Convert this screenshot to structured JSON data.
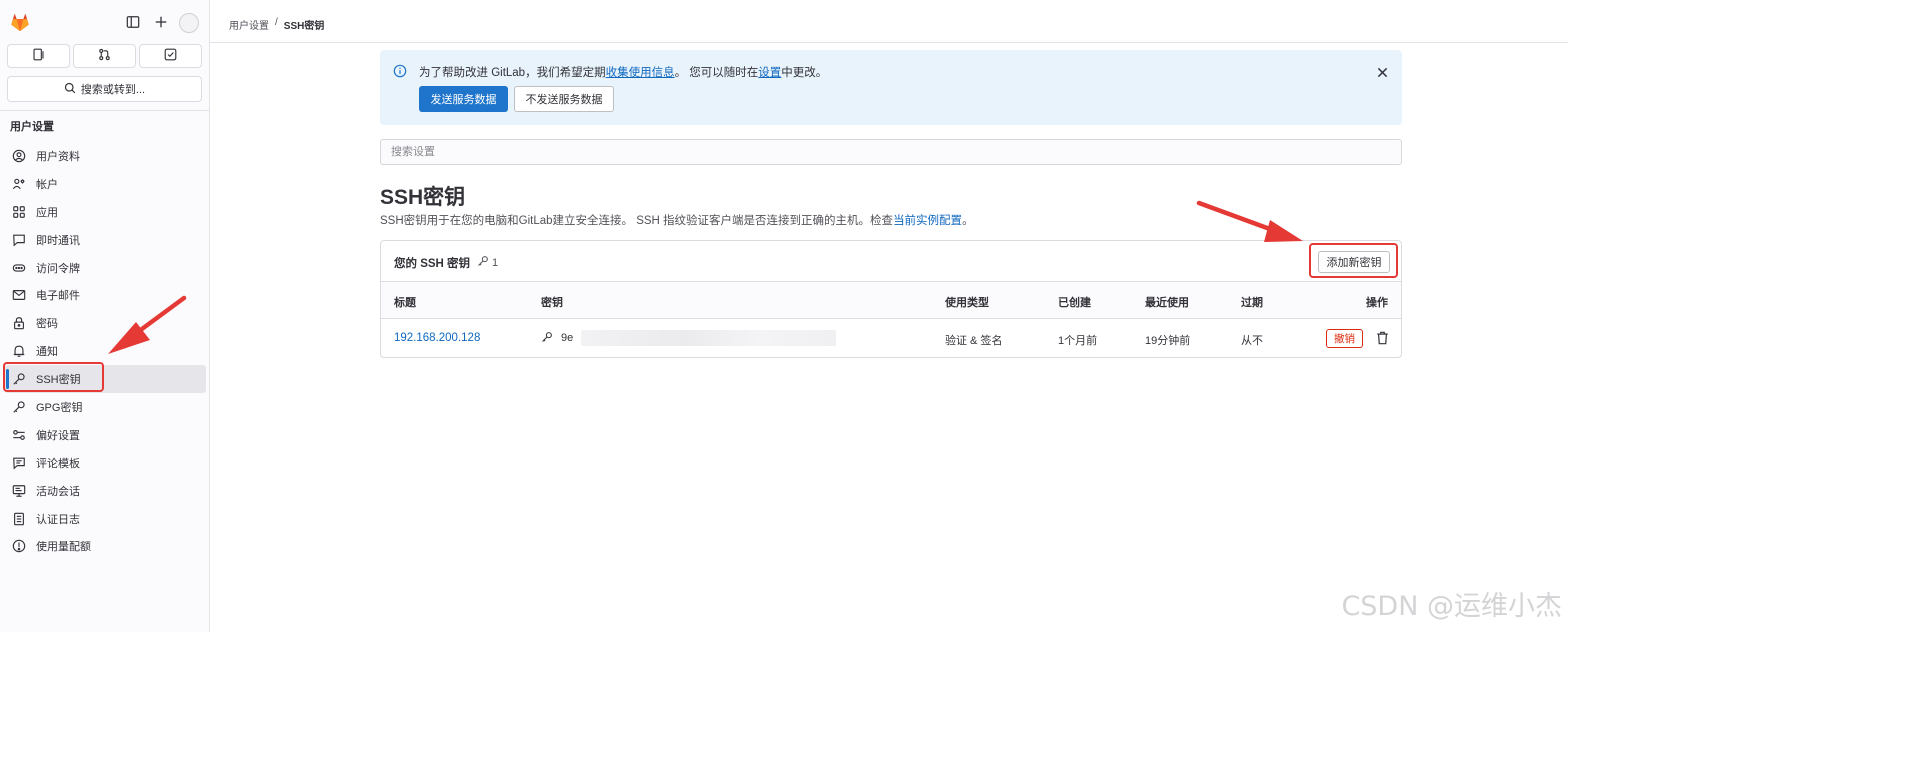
{
  "sidebar": {
    "search_label": "搜索或转到...",
    "section_title": "用户设置",
    "items": [
      {
        "label": "用户资料",
        "icon": "user-circle-icon"
      },
      {
        "label": "帐户",
        "icon": "account-icon"
      },
      {
        "label": "应用",
        "icon": "apps-icon"
      },
      {
        "label": "即时通讯",
        "icon": "chat-icon"
      },
      {
        "label": "访问令牌",
        "icon": "token-icon"
      },
      {
        "label": "电子邮件",
        "icon": "mail-icon"
      },
      {
        "label": "密码",
        "icon": "lock-icon"
      },
      {
        "label": "通知",
        "icon": "bell-icon"
      },
      {
        "label": "SSH密钥",
        "icon": "key-icon",
        "active": true
      },
      {
        "label": "GPG密钥",
        "icon": "key-icon"
      },
      {
        "label": "偏好设置",
        "icon": "preferences-icon"
      },
      {
        "label": "评论模板",
        "icon": "comment-template-icon"
      },
      {
        "label": "活动会话",
        "icon": "monitor-icon"
      },
      {
        "label": "认证日志",
        "icon": "log-icon"
      },
      {
        "label": "使用量配额",
        "icon": "quota-icon"
      }
    ]
  },
  "breadcrumb": {
    "parent": "用户设置",
    "separator": "/",
    "current": "SSH密钥"
  },
  "alert": {
    "text_before": "为了帮助改进 GitLab，我们希望定期",
    "link1": "收集使用信息",
    "text_middle": "。 您可以随时在",
    "link2": "设置",
    "text_after": "中更改。",
    "primary_button": "发送服务数据",
    "secondary_button": "不发送服务数据"
  },
  "search": {
    "placeholder": "搜索设置"
  },
  "page": {
    "title": "SSH密钥",
    "description": "SSH密钥用于在您的电脑和GitLab建立安全连接。 SSH 指纹验证客户端是否连接到正确的主机。检查",
    "description_link": "当前实例配置",
    "description_end": "。"
  },
  "keys_card": {
    "title": "您的 SSH 密钥",
    "count": "1",
    "add_button": "添加新密钥",
    "columns": [
      "标题",
      "密钥",
      "使用类型",
      "已创建",
      "最近使用",
      "过期",
      "操作"
    ],
    "rows": [
      {
        "title": "192.168.200.128",
        "key_prefix": "9e",
        "usage": "验证 & 签名",
        "created": "1个月前",
        "last_used": "19分钟前",
        "expires": "从不",
        "revoke": "撤销"
      }
    ]
  },
  "watermark": "CSDN @运维小杰",
  "colors": {
    "accent": "#1f75cb",
    "danger": "#dd2b0e",
    "annotation": "#e53935",
    "alert_bg": "#e9f3fc"
  }
}
